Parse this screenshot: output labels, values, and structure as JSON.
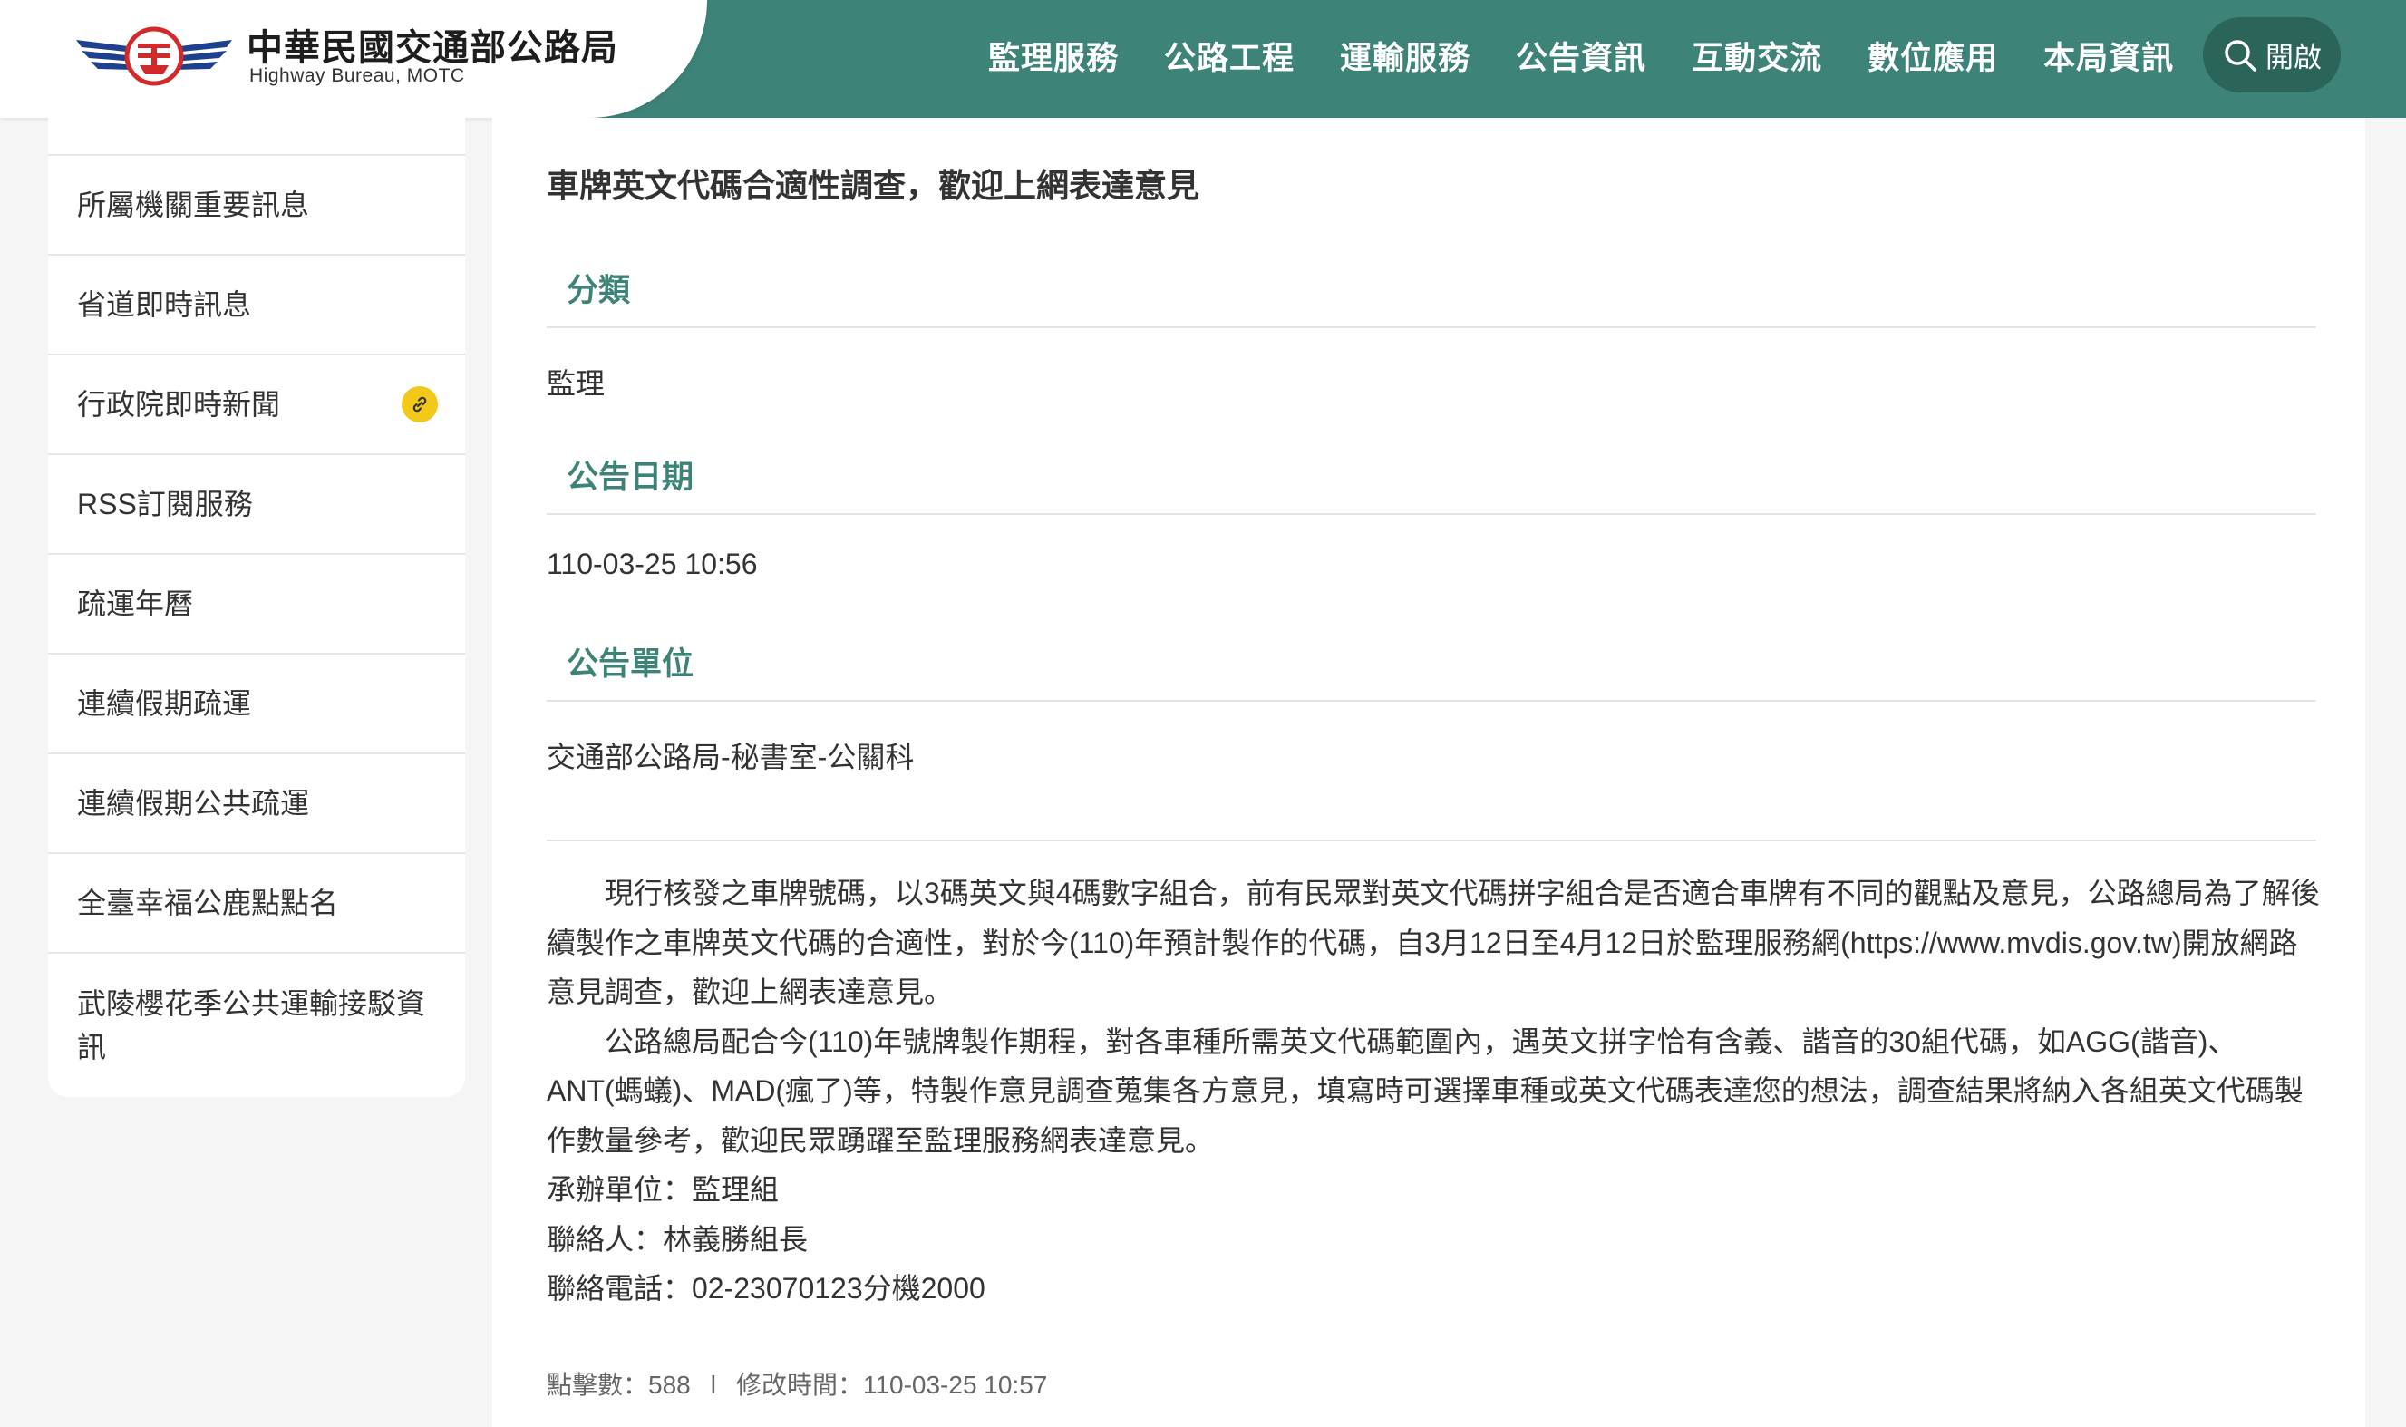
{
  "header": {
    "title": "中華民國交通部公路局",
    "subtitle": "Highway Bureau, MOTC",
    "nav": [
      "監理服務",
      "公路工程",
      "運輸服務",
      "公告資訊",
      "互動交流",
      "數位應用",
      "本局資訊"
    ],
    "search_label": "開啟",
    "colors": {
      "primary": "#3e8378",
      "accent": "#f2c81a"
    }
  },
  "sidebar": {
    "items": [
      {
        "label": "所屬機關重要訊息",
        "icon": ""
      },
      {
        "label": "省道即時訊息",
        "icon": ""
      },
      {
        "label": "行政院即時新聞",
        "icon": "link-icon"
      },
      {
        "label": "RSS訂閱服務",
        "icon": ""
      },
      {
        "label": "疏運年曆",
        "icon": ""
      },
      {
        "label": "連續假期疏運",
        "icon": ""
      },
      {
        "label": "連續假期公共疏運",
        "icon": ""
      },
      {
        "label": "全臺幸福公鹿點點名",
        "icon": ""
      },
      {
        "label": "武陵櫻花季公共運輸接駁資訊",
        "icon": ""
      }
    ]
  },
  "article": {
    "title": "車牌英文代碼合適性調查，歡迎上網表達意見",
    "category_label": "分類",
    "category": "監理",
    "date_label": "公告日期",
    "date": "110-03-25 10:56",
    "unit_label": "公告單位",
    "unit": "交通部公路局-秘書室-公關科",
    "paragraphs": [
      "現行核發之車牌號碼，以3碼英文與4碼數字組合，前有民眾對英文代碼拼字組合是否適合車牌有不同的觀點及意見，公路總局為了解後續製作之車牌英文代碼的合適性，對於今(110)年預計製作的代碼，自3月12日至4月12日於監理服務網(https://www.mvdis.gov.tw)開放網路意見調查，歡迎上網表達意見。",
      "公路總局配合今(110)年號牌製作期程，對各車種所需英文代碼範圍內，遇英文拼字恰有含義、諧音的30組代碼，如AGG(諧音)、ANT(螞蟻)、MAD(瘋了)等，特製作意見調查蒐集各方意見，填寫時可選擇車種或英文代碼表達您的想法，調查結果將納入各組英文代碼製作數量參考，歡迎民眾踴躍至監理服務網表達意見。"
    ],
    "contact_unit": "承辦單位：監理組",
    "contact_person": "聯絡人：林義勝組長",
    "contact_phone": "聯絡電話：02-23070123分機2000",
    "clicks": "點擊數：588",
    "separator": "l",
    "modified": "修改時間：110-03-25 10:57"
  }
}
